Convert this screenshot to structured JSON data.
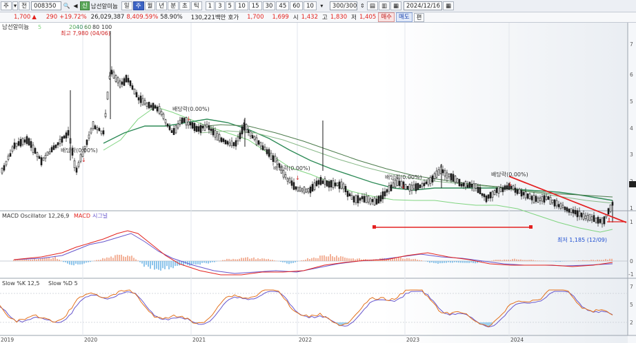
{
  "toolbar": {
    "market": "주",
    "market_dropdown": "▾",
    "scope": "전",
    "code": "008350",
    "name": "남선알미늄",
    "periods": [
      "일",
      "주",
      "월",
      "년",
      "분",
      "초",
      "틱"
    ],
    "selected_period": "주",
    "intervals": [
      "1",
      "3",
      "5",
      "10",
      "15",
      "30",
      "45",
      "60",
      "10"
    ],
    "count": "300",
    "count_total": "300",
    "date": "2024/12/16"
  },
  "quote": {
    "price": "1,700",
    "change": "290",
    "change_pct": "+19.72%",
    "volume": "26,029,387",
    "volume_ratio": "8,409.59%",
    "turnover_pct": "58.90%",
    "trade_value": "130,221백만",
    "ask_label": "호가",
    "ask": "1,700",
    "bid": "1,699",
    "open_label": "시",
    "open": "1,432",
    "high_label": "고",
    "high": "1,830",
    "low_label": "저",
    "low": "1,405",
    "buy_label": "매수",
    "sell_label": "매도",
    "extra_label": "편"
  },
  "panels": {
    "price": {
      "name": "남선알미늄",
      "ma_label": "5",
      "ma_periods": [
        "20",
        "40",
        "60",
        "80",
        "100"
      ],
      "high_annotation": "최고 7,980 (04/06)",
      "low_annotation": "최저 1,185 (12/09)",
      "dividend_labels": [
        "배당락(0.00%)",
        "배당락(0.00%)",
        "배당락(0.00%)",
        "배당락(0.00%)",
        "배당락(0.00%)"
      ],
      "y_ticks": [
        "7",
        "6",
        "5",
        "4",
        "3",
        "2",
        "1"
      ]
    },
    "macd": {
      "title": "MACD Oscillator 12,26,9",
      "macd_label": "MACD",
      "signal_label": "시그널",
      "y_ticks": [
        "1",
        "0",
        "-1"
      ]
    },
    "stoch": {
      "title": "Slow %K 12,5",
      "d_label": "Slow %D 5",
      "y_ticks": [
        "7",
        "5",
        "2"
      ]
    }
  },
  "x_axis": [
    "2019",
    "2020",
    "2021",
    "2022",
    "2023",
    "2024"
  ],
  "colors": {
    "up": "#e3211c",
    "down": "#1f4fd1",
    "candle": "#1a1a1a",
    "ma_short": "#7fd47f",
    "ma_mid": "#2e8b57",
    "ma_long": "#4a7a4a",
    "trendline": "#e32020",
    "macd_line": "#e3211c",
    "signal_line": "#6655cc",
    "osc_pos": "#f0a080",
    "osc_neg": "#6fb6e6"
  }
}
